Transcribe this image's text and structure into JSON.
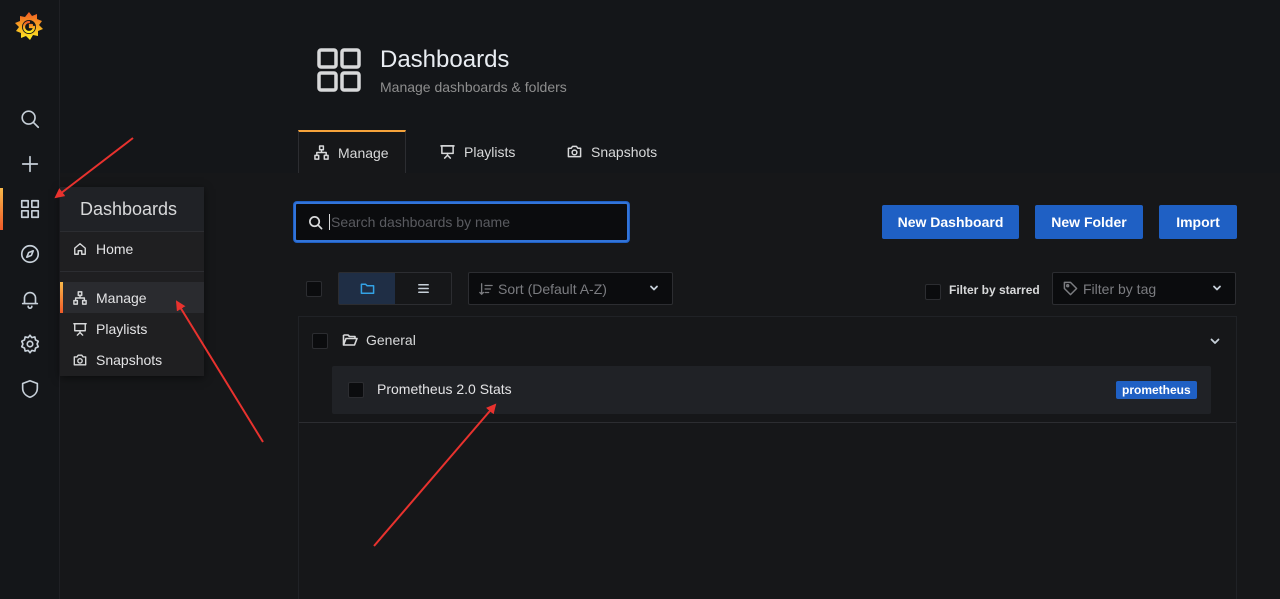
{
  "sidebar": {
    "logo": "grafana-logo",
    "icons": [
      "search-icon",
      "plus-icon",
      "dashboards-icon",
      "explore-icon",
      "alerting-icon",
      "configuration-icon",
      "server-admin-icon"
    ]
  },
  "flyout": {
    "title": "Dashboards",
    "items": [
      {
        "label": "Home",
        "icon": "home-icon"
      },
      {
        "label": "Manage",
        "icon": "sitemap-icon",
        "active": true
      },
      {
        "label": "Playlists",
        "icon": "presentation-icon"
      },
      {
        "label": "Snapshots",
        "icon": "camera-icon"
      }
    ]
  },
  "header": {
    "title": "Dashboards",
    "subtitle": "Manage dashboards & folders",
    "tabs": [
      {
        "label": "Manage",
        "icon": "sitemap-icon",
        "active": true
      },
      {
        "label": "Playlists",
        "icon": "presentation-icon"
      },
      {
        "label": "Snapshots",
        "icon": "camera-icon"
      }
    ]
  },
  "toolbar": {
    "search_placeholder": "Search dashboards by name",
    "new_dashboard": "New Dashboard",
    "new_folder": "New Folder",
    "import": "Import",
    "sort_placeholder": "Sort (Default A-Z)",
    "filter_starred": "Filter by starred",
    "filter_tag_placeholder": "Filter by tag",
    "view_mode": "folders"
  },
  "list": {
    "folders": [
      {
        "name": "General",
        "dashboards": [
          {
            "title": "Prometheus 2.0 Stats",
            "tags": [
              "prometheus"
            ]
          }
        ]
      }
    ]
  },
  "colors": {
    "accent": "#f5a33b",
    "primary_button": "#1f60c4",
    "annotation": "#e8322e"
  }
}
